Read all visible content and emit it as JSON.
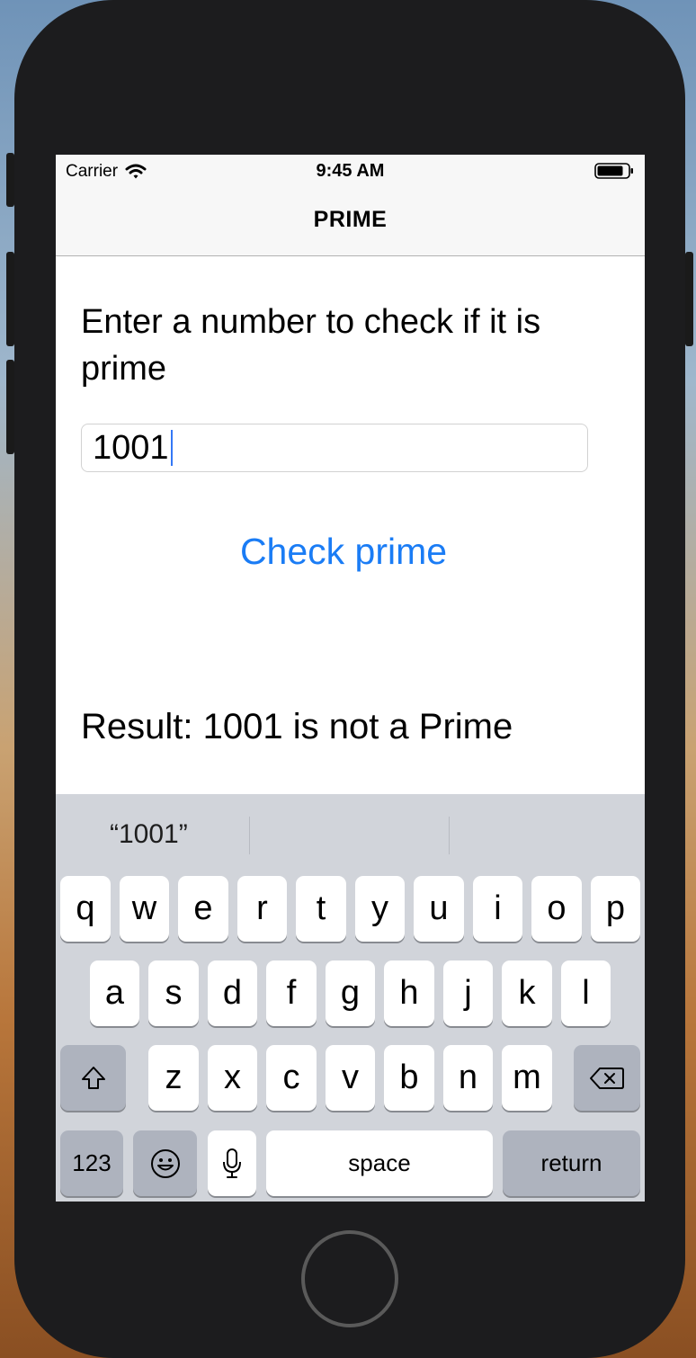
{
  "status_bar": {
    "carrier": "Carrier",
    "time": "9:45 AM"
  },
  "nav": {
    "title": "PRIME"
  },
  "content": {
    "prompt": "Enter a number to check if it is prime",
    "input_value": "1001",
    "check_button": "Check prime",
    "result": "Result: 1001 is not a Prime"
  },
  "keyboard": {
    "suggestion": "“1001”",
    "row1": [
      "q",
      "w",
      "e",
      "r",
      "t",
      "y",
      "u",
      "i",
      "o",
      "p"
    ],
    "row2": [
      "a",
      "s",
      "d",
      "f",
      "g",
      "h",
      "j",
      "k",
      "l"
    ],
    "row3": [
      "z",
      "x",
      "c",
      "v",
      "b",
      "n",
      "m"
    ],
    "numbers_key": "123",
    "space_key": "space",
    "return_key": "return"
  },
  "colors": {
    "accent": "#1a7cf5",
    "keyboard_bg": "#d1d4da",
    "key_dark": "#aeb3be"
  }
}
